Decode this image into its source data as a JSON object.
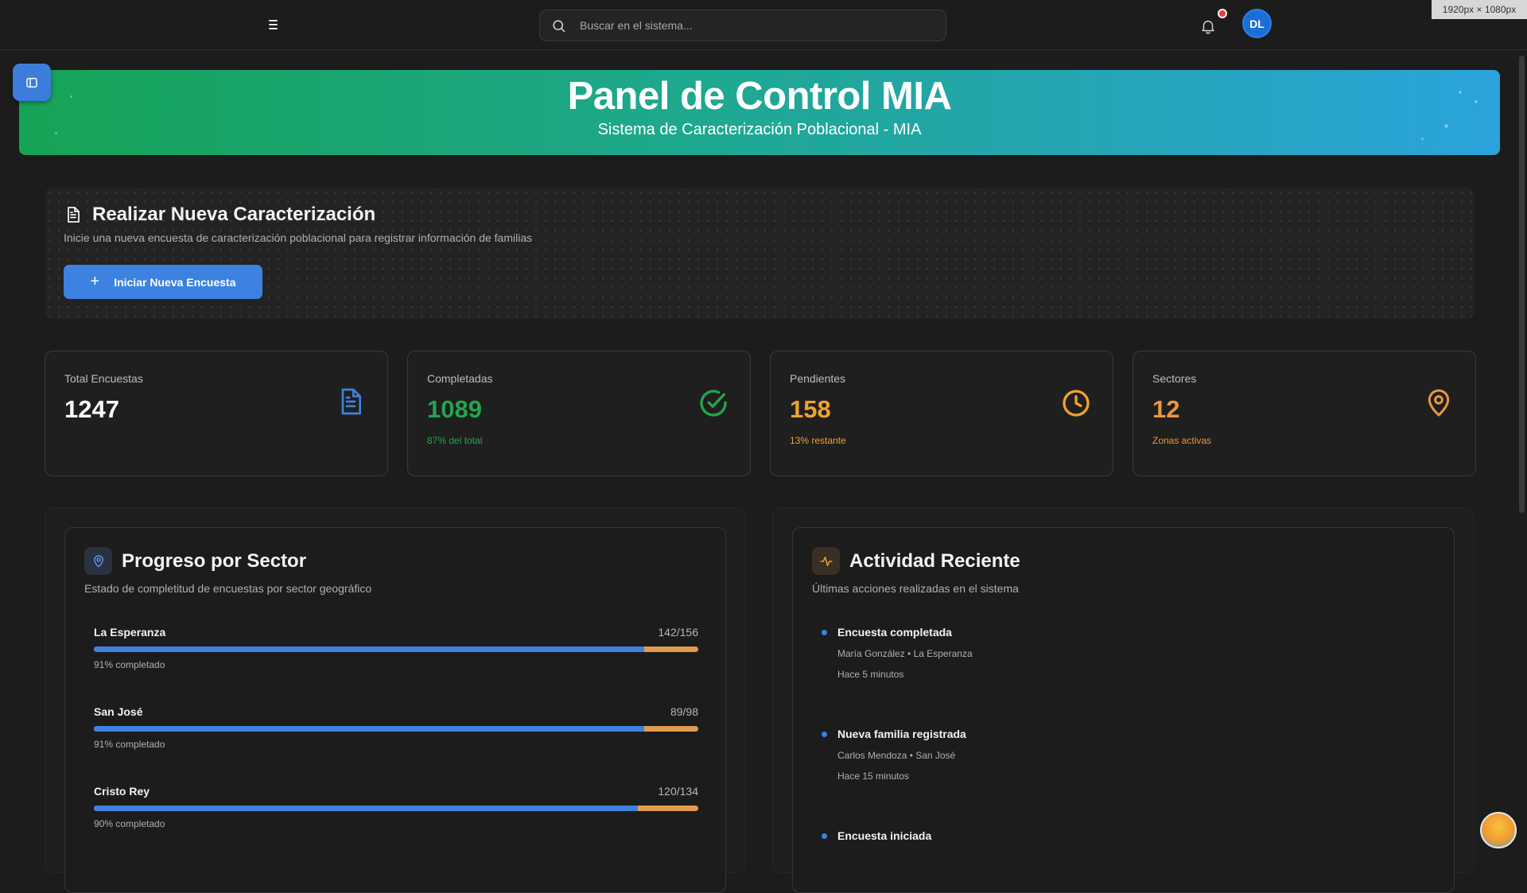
{
  "topbar": {
    "search_placeholder": "Buscar en el sistema...",
    "avatar_initials": "DL",
    "dimension_badge": "1920px × 1080px"
  },
  "hero": {
    "title": "Panel de Control MIA",
    "subtitle": "Sistema de Caracterización Poblacional - MIA"
  },
  "new_survey": {
    "title": "Realizar Nueva Caracterización",
    "description": "Inicie una nueva encuesta de caracterización poblacional para registrar información de familias",
    "button_label": "Iniciar Nueva Encuesta"
  },
  "stats": [
    {
      "label": "Total Encuestas",
      "value": "1247",
      "sub": "",
      "color": "#ffffff",
      "icon": "document-icon"
    },
    {
      "label": "Completadas",
      "value": "1089",
      "sub": "87% del total",
      "color": "#22a64b",
      "icon": "check-circle-icon"
    },
    {
      "label": "Pendientes",
      "value": "158",
      "sub": "13% restante",
      "color": "#f0a22b",
      "icon": "clock-icon"
    },
    {
      "label": "Sectores",
      "value": "12",
      "sub": "Zonas activas",
      "color": "#e8973f",
      "icon": "map-pin-icon"
    }
  ],
  "progress": {
    "title": "Progreso por Sector",
    "description": "Estado de completitud de encuestas por sector geográfico",
    "sectors": [
      {
        "name": "La Esperanza",
        "count": "142/156",
        "percent_label": "91% completado",
        "fraction": 0.91
      },
      {
        "name": "San José",
        "count": "89/98",
        "percent_label": "91% completado",
        "fraction": 0.91
      },
      {
        "name": "Cristo Rey",
        "count": "120/134",
        "percent_label": "90% completado",
        "fraction": 0.9
      }
    ]
  },
  "activity": {
    "title": "Actividad Reciente",
    "description": "Últimas acciones realizadas en el sistema",
    "items": [
      {
        "title": "Encuesta completada",
        "detail": "María González • La Esperanza",
        "time": "Hace 5 minutos"
      },
      {
        "title": "Nueva familia registrada",
        "detail": "Carlos Mendoza • San José",
        "time": "Hace 15 minutos"
      },
      {
        "title": "Encuesta iniciada",
        "detail": "",
        "time": ""
      }
    ]
  },
  "colors": {
    "accent_blue": "#3d82e0",
    "progress_remaining": "#e29b4f",
    "success_green": "#22a64b",
    "warning_orange": "#f0a22b"
  }
}
